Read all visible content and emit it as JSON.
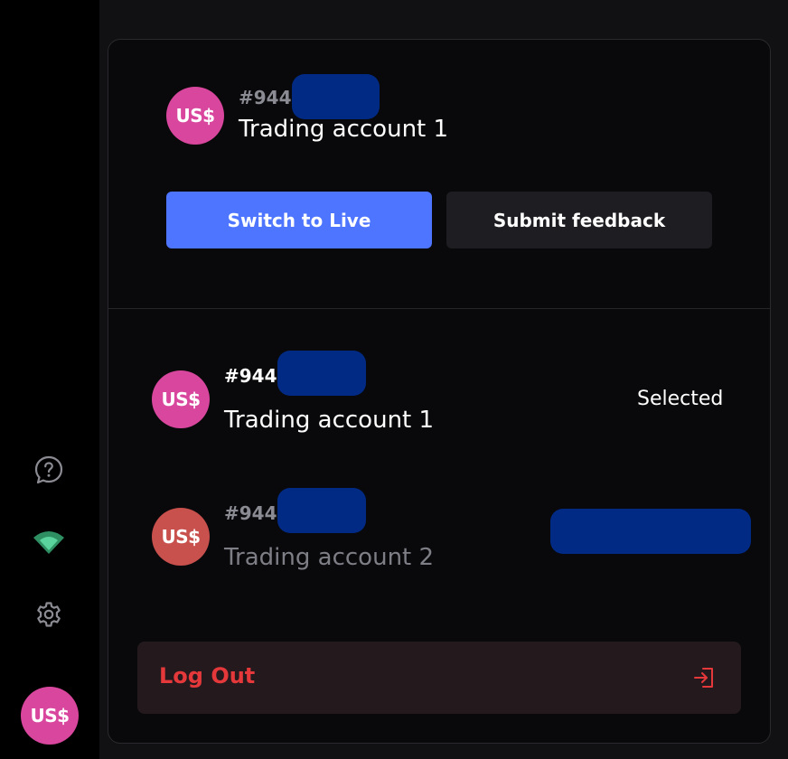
{
  "sidebar": {
    "icons": {
      "help": "help-icon",
      "network": "network-status-icon",
      "settings": "gear-icon"
    },
    "avatar_label": "US$",
    "status_color": "#3fbf86"
  },
  "header": {
    "avatar_label": "US$",
    "account_number": "#944",
    "account_name": "Trading account 1"
  },
  "actions": {
    "switch_label": "Switch to Live",
    "feedback_label": "Submit feedback"
  },
  "accounts": [
    {
      "avatar_label": "US$",
      "avatar_color": "#d9469e",
      "number": "#944",
      "name": "Trading account 1",
      "status": "Selected"
    },
    {
      "avatar_label": "US$",
      "avatar_color": "#c8504d",
      "number": "#944",
      "name": "Trading account 2"
    }
  ],
  "logout": {
    "label": "Log Out",
    "icon": "logout-icon"
  },
  "colors": {
    "accent": "#4e75ff",
    "avatar_pink": "#d9469e",
    "danger": "#e5383b"
  }
}
